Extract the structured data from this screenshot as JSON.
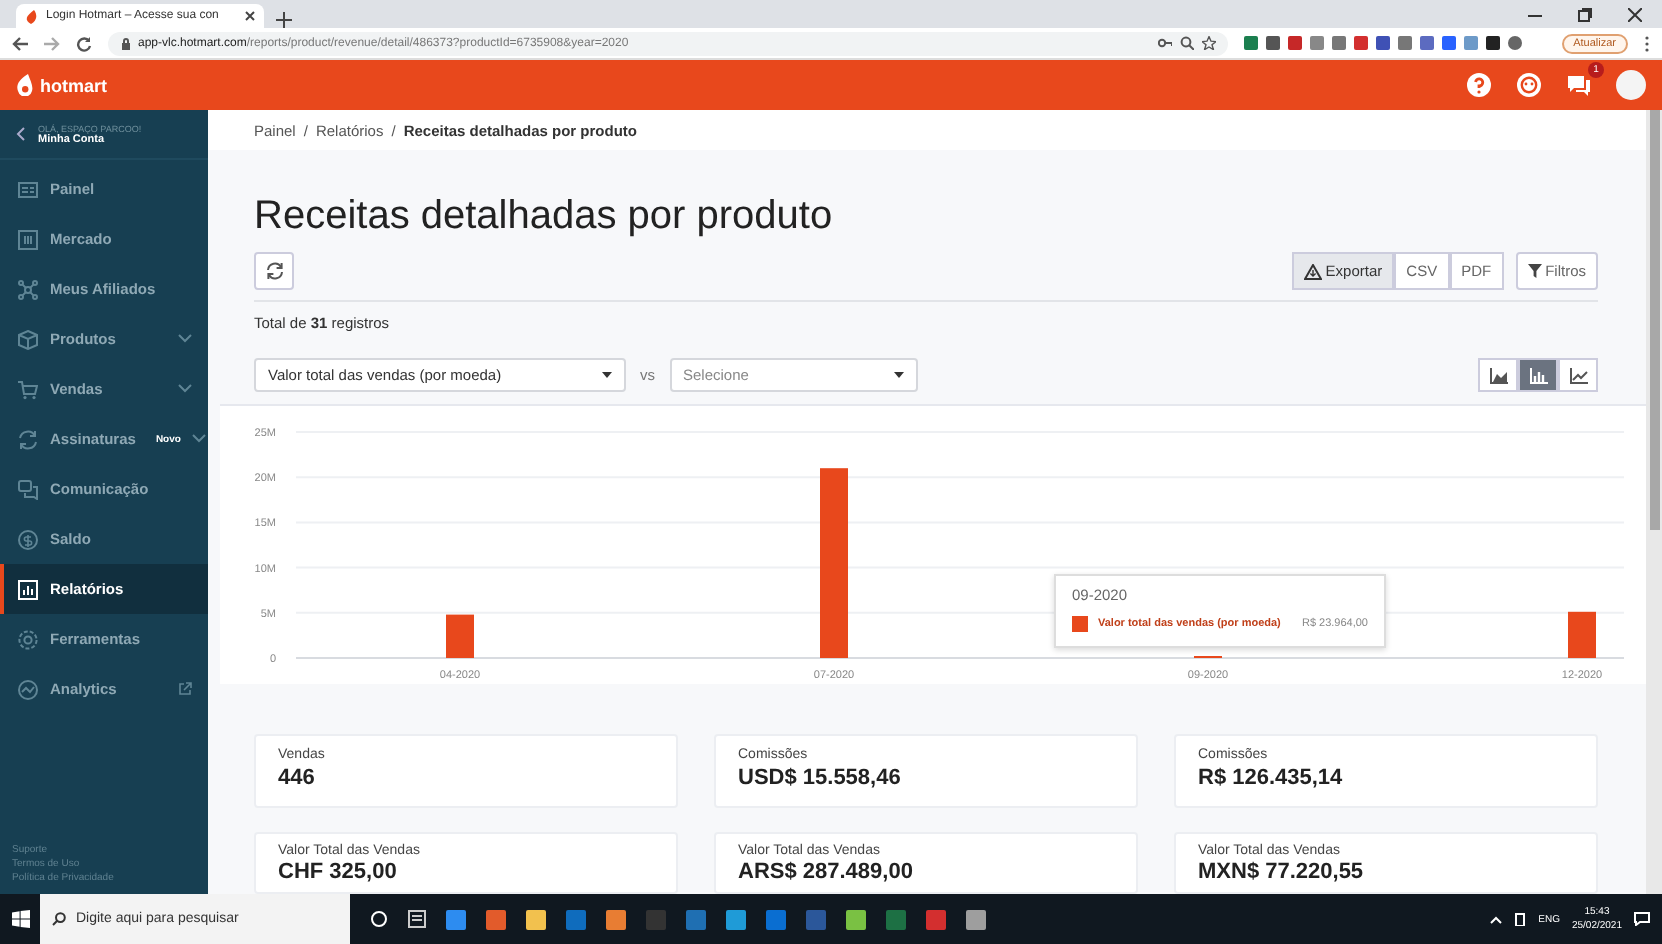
{
  "browser": {
    "tab_title": "Login Hotmart – Acesse sua con",
    "url_host": "app-vlc.hotmart.com",
    "url_path": "/reports/product/revenue/detail/486373?productId=6735908&year=2020",
    "update_button": "Atualizar"
  },
  "header": {
    "logo": "hotmart",
    "notification_count": "1"
  },
  "sidebar": {
    "account_label": "OLÁ, ESPAÇO PARCOO!",
    "account_name": "Minha Conta",
    "items": [
      {
        "label": "Painel",
        "kind": "plain",
        "selected": false
      },
      {
        "label": "Mercado",
        "kind": "plain",
        "selected": false
      },
      {
        "label": "Meus Afiliados",
        "kind": "plain",
        "selected": false
      },
      {
        "label": "Produtos",
        "kind": "expandable",
        "selected": false
      },
      {
        "label": "Vendas",
        "kind": "expandable",
        "selected": false
      },
      {
        "label": "Assinaturas",
        "kind": "expandable",
        "badge": "Novo",
        "selected": false
      },
      {
        "label": "Comunicação",
        "kind": "plain",
        "selected": false
      },
      {
        "label": "Saldo",
        "kind": "plain",
        "selected": false
      },
      {
        "label": "Relatórios",
        "kind": "plain",
        "selected": true
      },
      {
        "label": "Ferramentas",
        "kind": "plain",
        "selected": false
      },
      {
        "label": "Analytics",
        "kind": "external",
        "selected": false
      }
    ],
    "footer_links": [
      "Suporte",
      "Termos de Uso",
      "Política de Privacidade"
    ]
  },
  "breadcrumb_separator": "/",
  "breadcrumb": [
    {
      "label": "Painel",
      "current": false
    },
    {
      "label": "Relatórios",
      "current": false
    },
    {
      "label": "Receitas detalhadas por produto",
      "current": true
    }
  ],
  "page_title": "Receitas detalhadas por produto",
  "export": {
    "label": "Exportar",
    "formats": [
      "CSV",
      "PDF"
    ]
  },
  "filters_button": "Filtros",
  "total": "Total de **31** registros",
  "metric_select": {
    "value": "Valor total das vendas (por moeda)"
  },
  "vs_label": "vs",
  "compare_select": {
    "placeholder": "Selecione"
  },
  "chart_types": [
    {
      "kind": "area",
      "selected": false
    },
    {
      "kind": "bar",
      "selected": true
    },
    {
      "kind": "line",
      "selected": false
    }
  ],
  "chart": {
    "chart_data": {
      "type": "bar",
      "categories": [
        "04-2020",
        "07-2020",
        "09-2020",
        "12-2020"
      ],
      "series": [
        {
          "name": "Valor total das vendas (por moeda)",
          "color": "#e8481c",
          "values": [
            4800000,
            21000000,
            24000,
            5100000
          ]
        }
      ],
      "grid": true,
      "ylim": [
        0,
        25000000
      ],
      "yticks": [
        {
          "value": 0,
          "label": "0"
        },
        {
          "value": 5000000,
          "label": "5M"
        },
        {
          "value": 10000000,
          "label": "10M"
        },
        {
          "value": 15000000,
          "label": "15M"
        },
        {
          "value": 20000000,
          "label": "20M"
        },
        {
          "value": 25000000,
          "label": "25M"
        }
      ]
    },
    "tooltip": {
      "title": "09-2020",
      "value": "R$ 23.964,00"
    }
  },
  "cards": [
    {
      "label": "Vendas",
      "value": "446"
    },
    {
      "label": "Comissões",
      "value": "USD$ 15.558,46"
    },
    {
      "label": "Comissões",
      "value": "R$ 126.435,14"
    },
    {
      "label": "Valor Total das Vendas",
      "value": "CHF 325,00"
    },
    {
      "label": "Valor Total das Vendas",
      "value": "ARS$ 287.489,00"
    },
    {
      "label": "Valor Total das Vendas",
      "value": "MXN$ 77.220,55"
    }
  ],
  "taskbar": {
    "search_placeholder": "Digite aqui para pesquisar",
    "language": "ENG",
    "time": "15:43",
    "date": "25/02/2021"
  }
}
